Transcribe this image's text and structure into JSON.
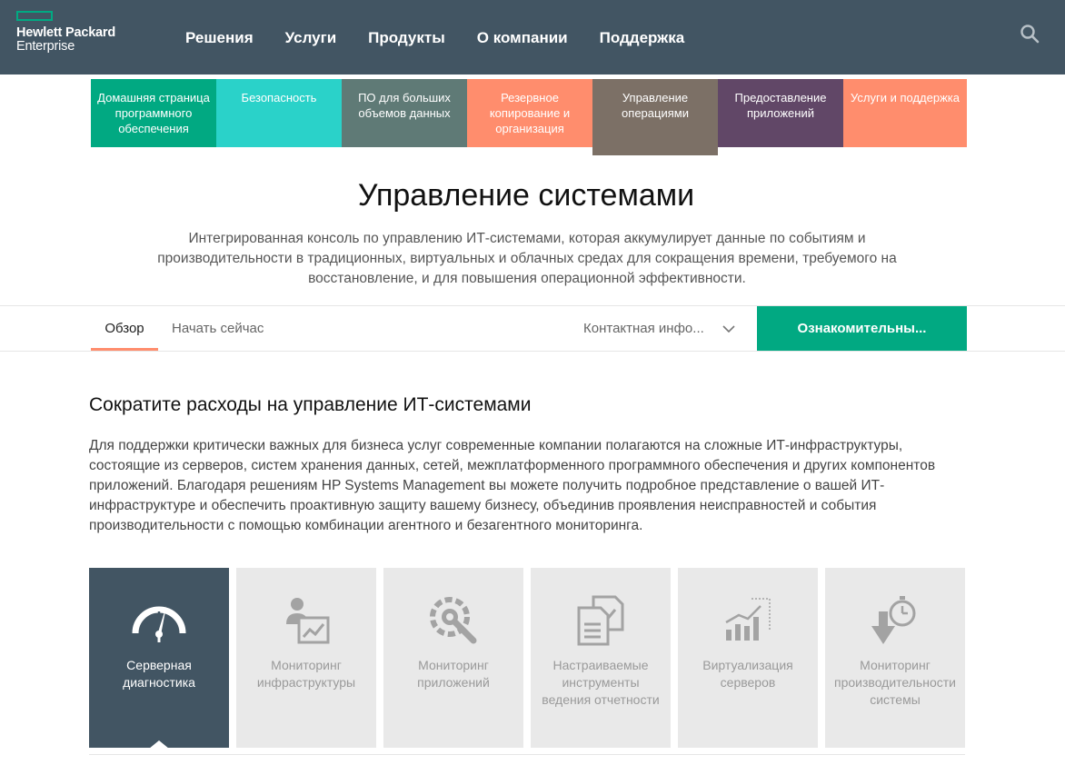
{
  "header": {
    "logo_line1": "Hewlett Packard",
    "logo_line2": "Enterprise",
    "nav": [
      "Решения",
      "Услуги",
      "Продукты",
      "О компании",
      "Поддержка"
    ],
    "search_icon": "search-icon",
    "colors": {
      "bar": "#425563",
      "logo_accent": "#01a982"
    }
  },
  "categories": [
    {
      "label": "Домашняя страница программного обеспечения",
      "color": "#01a982",
      "active": false
    },
    {
      "label": "Безопасность",
      "color": "#2ad2c9",
      "active": false
    },
    {
      "label": "ПО для больших объемов данных",
      "color": "#5f7a76",
      "active": false
    },
    {
      "label": "Резервное копирование и организация",
      "color": "#ff8d6d",
      "active": false
    },
    {
      "label": "Управление операциями",
      "color": "#7c7066",
      "active": true
    },
    {
      "label": "Предоставление приложений",
      "color": "#614767",
      "active": false
    },
    {
      "label": "Услуги и поддержка",
      "color": "#ff8d6d",
      "active": false
    }
  ],
  "page": {
    "title": "Управление системами",
    "description": "Интегрированная консоль по управлению ИТ-системами, которая аккумулирует данные по событиям и производительности в традиционных, виртуальных и облачных средах для сокращения времени, требуемого на восстановление, и для повышения операционной эффективности."
  },
  "tabs": {
    "overview": "Обзор",
    "start": "Начать сейчас",
    "contact": "Контактная инфо...",
    "trial": "Ознакомительны..."
  },
  "section": {
    "heading": "Сократите расходы на управление ИТ-системами",
    "body": "Для поддержки критически важных для бизнеса услуг современные компании полагаются на сложные ИТ-инфраструктуры, состоящие из серверов, систем хранения данных, сетей, межплатформенного программного обеспечения и других компонентов приложений. Благодаря решениям HP Systems Management вы можете получить подробное представление о вашей ИТ-инфраструктуре и обеспечить проактивную защиту вашему бизнесу, объединив проявления неисправностей и события производительности с помощью комбинации агентного и безагентного мониторинга."
  },
  "features": [
    {
      "label": "Серверная диагностика",
      "icon": "gauge-icon",
      "active": true
    },
    {
      "label": "Мониторинг инфраструктуры",
      "icon": "user-chart-icon",
      "active": false
    },
    {
      "label": "Мониторинг приложений",
      "icon": "wrench-gear-icon",
      "active": false
    },
    {
      "label": "Настраиваемые инструменты ведения отчетности",
      "icon": "documents-icon",
      "active": false
    },
    {
      "label": "Виртуализация серверов",
      "icon": "bar-growth-icon",
      "active": false
    },
    {
      "label": "Мониторинг производительности системы",
      "icon": "stopwatch-download-icon",
      "active": false
    }
  ]
}
